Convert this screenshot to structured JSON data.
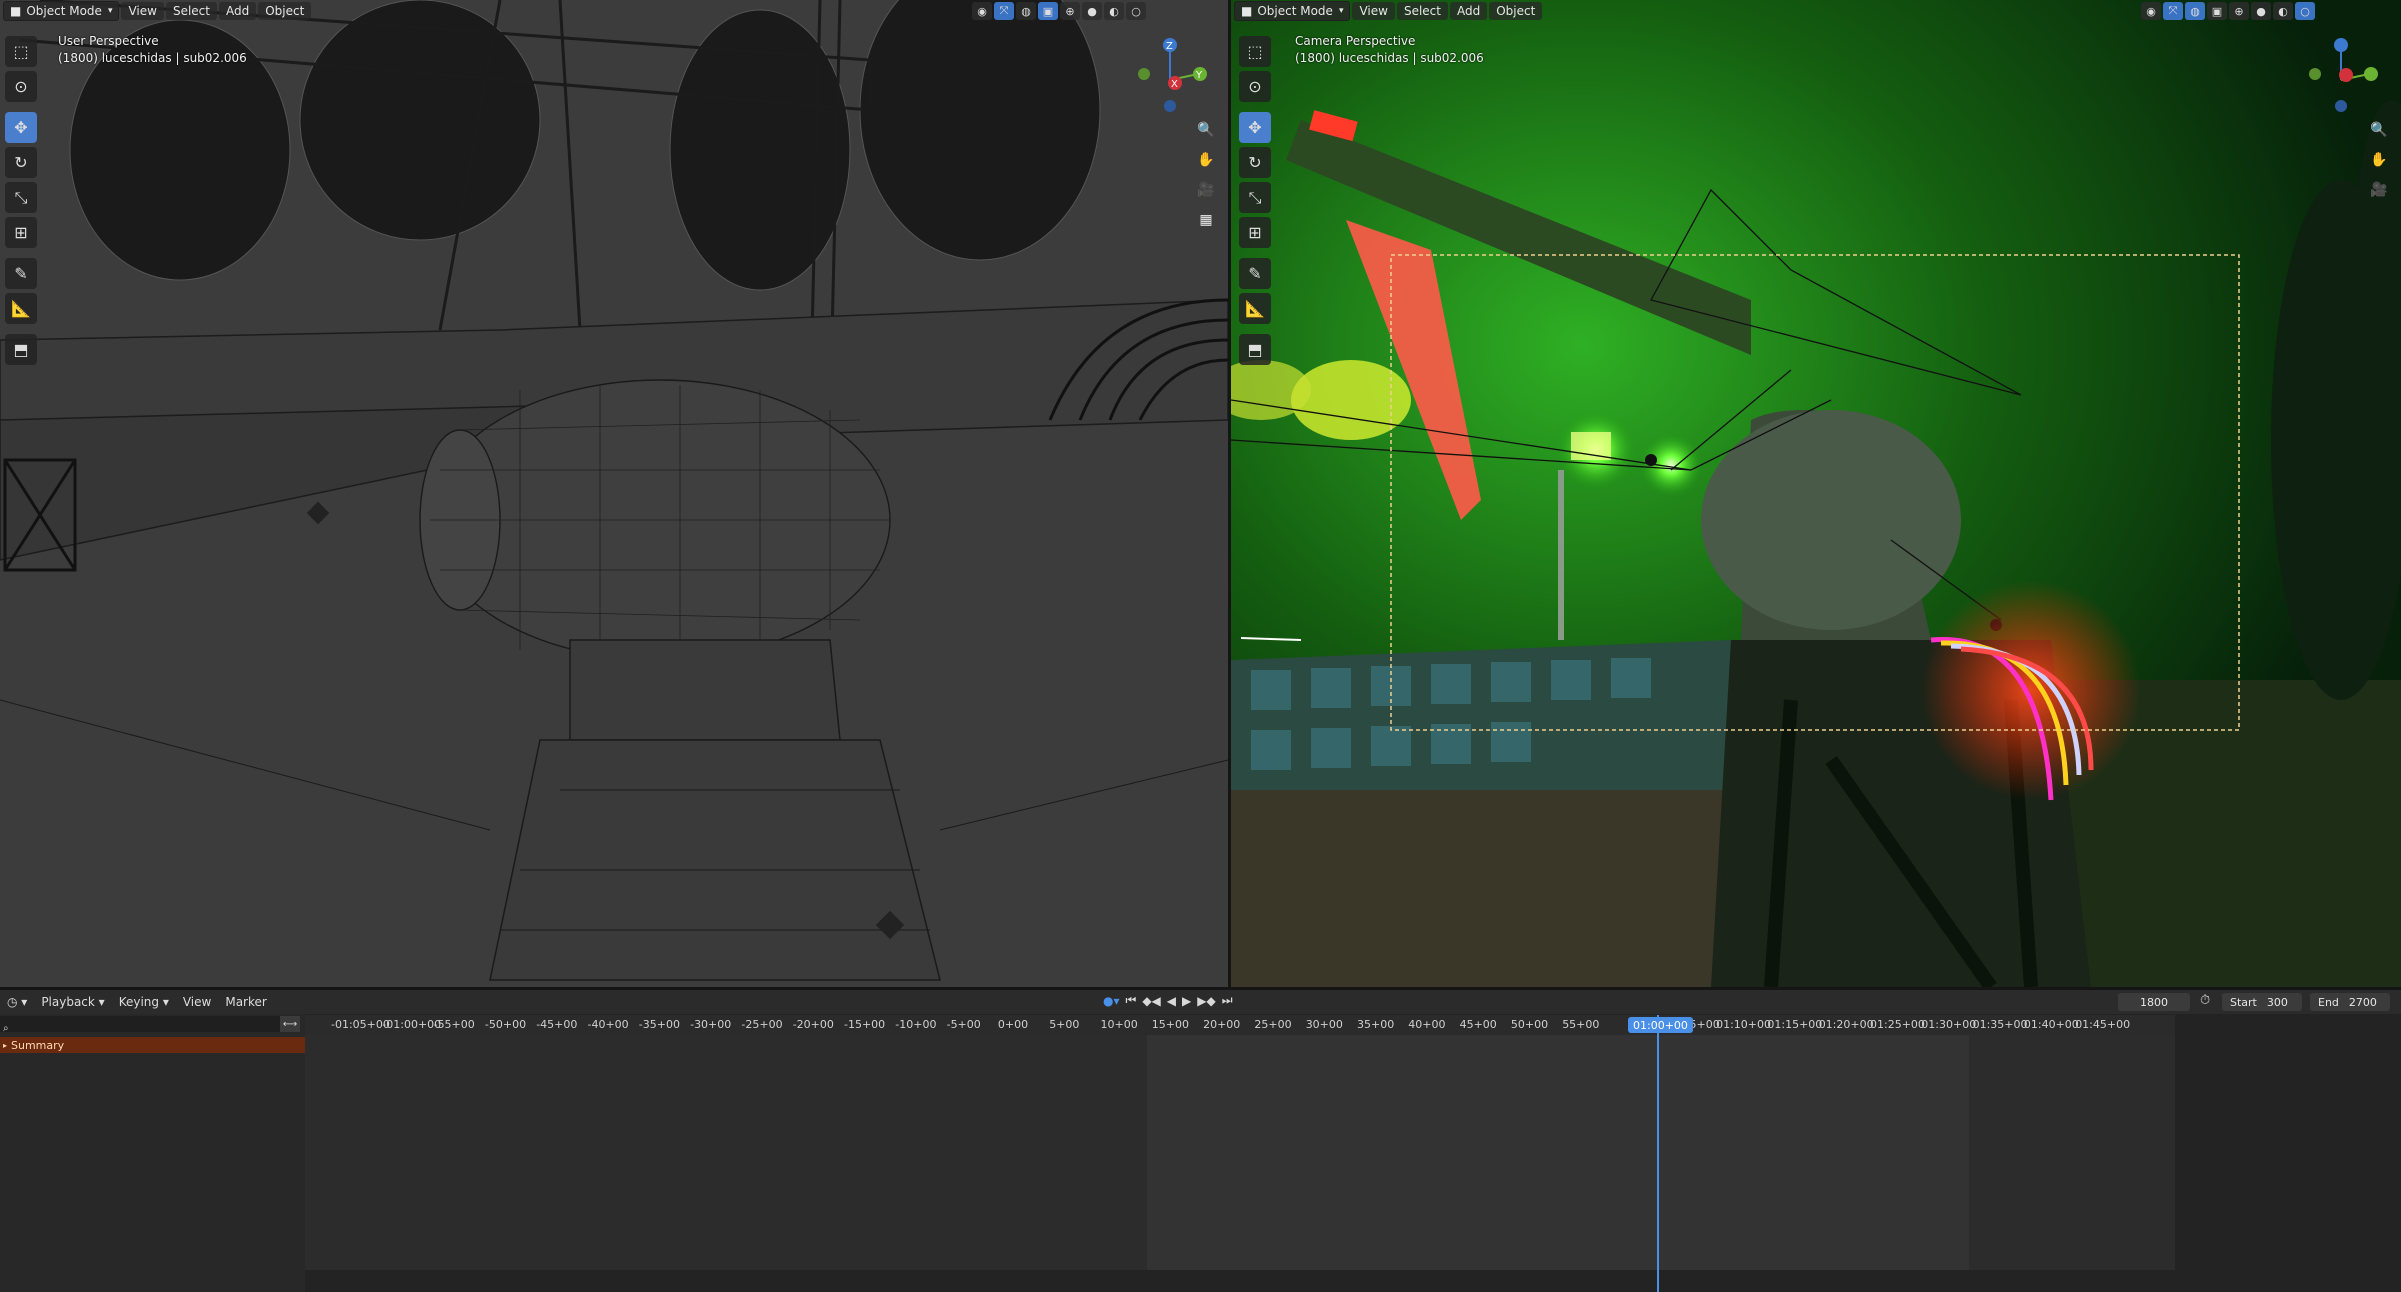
{
  "left_viewport": {
    "mode_label": "Object Mode",
    "menus": [
      "View",
      "Select",
      "Add",
      "Object"
    ],
    "perspective": "User Perspective",
    "object_info": "(1800) luceschidas | sub02.006"
  },
  "right_viewport": {
    "mode_label": "Object Mode",
    "menus": [
      "View",
      "Select",
      "Add",
      "Object"
    ],
    "perspective": "Camera Perspective",
    "object_info": "(1800) luceschidas | sub02.006"
  },
  "gizmo": {
    "x": "X",
    "y": "Y",
    "z": "Z"
  },
  "colors": {
    "accent": "#4a7fce",
    "summary": "#6a2a10",
    "playhead": "#4a90e8"
  },
  "timeline": {
    "menus": [
      "Playback",
      "Keying",
      "View",
      "Marker"
    ],
    "current_frame": "1800",
    "start_label": "Start",
    "start_value": "300",
    "end_label": "End",
    "end_value": "2700",
    "summary_label": "Summary",
    "playhead_label": "01:00+00",
    "ruler_labels": [
      "-01:05+00",
      "-01:00+00",
      "-55+00",
      "-50+00",
      "-45+00",
      "-40+00",
      "-35+00",
      "-30+00",
      "-25+00",
      "-20+00",
      "-15+00",
      "-10+00",
      "-5+00",
      "0+00",
      "5+00",
      "10+00",
      "15+00",
      "20+00",
      "25+00",
      "30+00",
      "35+00",
      "40+00",
      "45+00",
      "50+00",
      "55+00",
      "01:00+00",
      "01:05+00",
      "01:10+00",
      "01:15+00",
      "01:20+00",
      "01:25+00",
      "01:30+00",
      "01:35+00",
      "01:40+00",
      "01:45+00"
    ]
  }
}
